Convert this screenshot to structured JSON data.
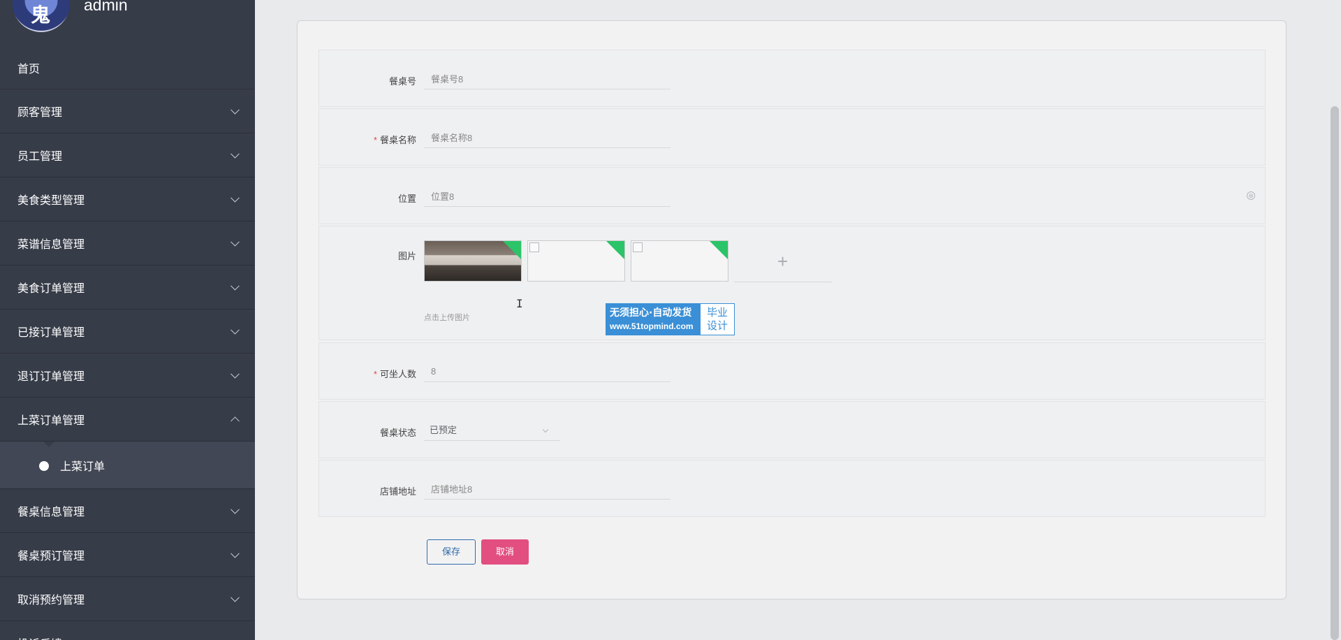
{
  "sidebar": {
    "username": "admin",
    "avatar_glyph": "鬼",
    "items": [
      {
        "label": "首页"
      },
      {
        "label": "顾客管理"
      },
      {
        "label": "员工管理"
      },
      {
        "label": "美食类型管理"
      },
      {
        "label": "菜谱信息管理"
      },
      {
        "label": "美食订单管理"
      },
      {
        "label": "已接订单管理"
      },
      {
        "label": "退订订单管理"
      },
      {
        "label": "上菜订单管理"
      },
      {
        "label": "餐桌信息管理"
      },
      {
        "label": "餐桌预订管理"
      },
      {
        "label": "取消预约管理"
      },
      {
        "label": "投诉反馈"
      }
    ],
    "submenu": {
      "label": "上菜订单"
    }
  },
  "form": {
    "table_no": {
      "label": "餐桌号",
      "value": "餐桌号8"
    },
    "table_name": {
      "label": "餐桌名称",
      "required_mark": "*",
      "value": "餐桌名称8"
    },
    "position": {
      "label": "位置",
      "value": "位置8"
    },
    "image": {
      "label": "图片",
      "hint": "点击上传图片",
      "add_symbol": "+"
    },
    "seats": {
      "label": "可坐人数",
      "required_mark": "*",
      "value": "8"
    },
    "status": {
      "label": "餐桌状态",
      "value": "已预定"
    },
    "address": {
      "label": "店铺地址",
      "value": "店铺地址8"
    },
    "save_label": "保存",
    "cancel_label": "取消"
  },
  "watermark": {
    "line1": "无须担心·自动发货",
    "line2": "www.51topmind.com",
    "right1": "毕业",
    "right2": "设计"
  },
  "icons": {
    "clear": "⊗",
    "cursor": "I"
  },
  "colors": {
    "sidebar_bg": "#363c48",
    "save_border": "#2f6aa6",
    "cancel_bg": "#e24e80",
    "thumb_corner": "#2bc468"
  }
}
